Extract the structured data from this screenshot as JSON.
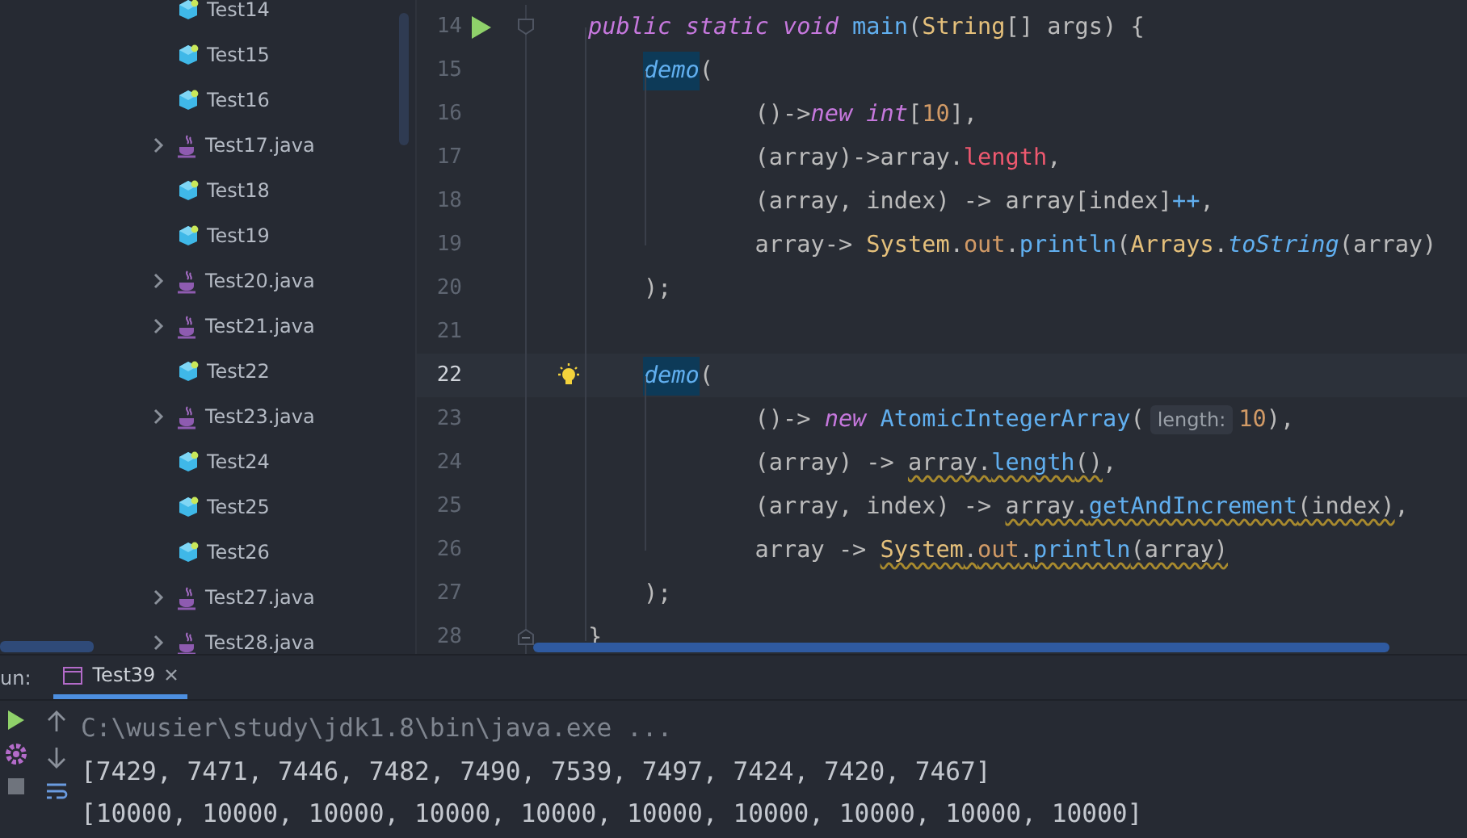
{
  "project_tree": {
    "items": [
      {
        "label": "Test14",
        "kind": "class",
        "expandable": false
      },
      {
        "label": "Test15",
        "kind": "class",
        "expandable": false
      },
      {
        "label": "Test16",
        "kind": "class",
        "expandable": false
      },
      {
        "label": "Test17.java",
        "kind": "file",
        "expandable": true
      },
      {
        "label": "Test18",
        "kind": "class",
        "expandable": false
      },
      {
        "label": "Test19",
        "kind": "class",
        "expandable": false
      },
      {
        "label": "Test20.java",
        "kind": "file",
        "expandable": true
      },
      {
        "label": "Test21.java",
        "kind": "file",
        "expandable": true
      },
      {
        "label": "Test22",
        "kind": "class",
        "expandable": false
      },
      {
        "label": "Test23.java",
        "kind": "file",
        "expandable": true
      },
      {
        "label": "Test24",
        "kind": "class",
        "expandable": false
      },
      {
        "label": "Test25",
        "kind": "class",
        "expandable": false
      },
      {
        "label": "Test26",
        "kind": "class",
        "expandable": false
      },
      {
        "label": "Test27.java",
        "kind": "file",
        "expandable": true
      },
      {
        "label": "Test28.java",
        "kind": "file",
        "expandable": true
      }
    ]
  },
  "editor": {
    "lines": [
      {
        "number": "14",
        "current": false,
        "gutter": {
          "kind": "run"
        },
        "fold": {
          "kind": "start"
        },
        "tokens": [
          {
            "text": "public static void ",
            "kind": "keyword"
          },
          {
            "text": "main",
            "kind": "method"
          },
          {
            "text": "(",
            "kind": "plain"
          },
          {
            "text": "String",
            "kind": "type"
          },
          {
            "text": "[] args) {",
            "kind": "plain"
          }
        ]
      },
      {
        "number": "15",
        "current": false,
        "tokens": [
          {
            "text": "    demo",
            "kind": "call_highlight"
          },
          {
            "text": "(",
            "kind": "plain"
          }
        ]
      },
      {
        "number": "16",
        "current": false,
        "tokens": [
          {
            "text": "            ()->",
            "kind": "plain"
          },
          {
            "text": "new int",
            "kind": "keyword"
          },
          {
            "text": "[",
            "kind": "plain"
          },
          {
            "text": "10",
            "kind": "number"
          },
          {
            "text": "],",
            "kind": "plain"
          }
        ]
      },
      {
        "number": "17",
        "current": false,
        "tokens": [
          {
            "text": "            (array)->array.",
            "kind": "plain"
          },
          {
            "text": "length",
            "kind": "field"
          },
          {
            "text": ",",
            "kind": "plain"
          }
        ]
      },
      {
        "number": "18",
        "current": false,
        "tokens": [
          {
            "text": "            (array, index) -> array[index]",
            "kind": "plain"
          },
          {
            "text": "++",
            "kind": "method"
          },
          {
            "text": ",",
            "kind": "plain"
          }
        ]
      },
      {
        "number": "19",
        "current": false,
        "tokens": [
          {
            "text": "            array-> ",
            "kind": "plain"
          },
          {
            "text": "System",
            "kind": "type"
          },
          {
            "text": ".",
            "kind": "plain"
          },
          {
            "text": "out",
            "kind": "static_field"
          },
          {
            "text": ".",
            "kind": "plain"
          },
          {
            "text": "println",
            "kind": "method"
          },
          {
            "text": "(",
            "kind": "plain"
          },
          {
            "text": "Arrays",
            "kind": "type"
          },
          {
            "text": ".",
            "kind": "plain"
          },
          {
            "text": "toString",
            "kind": "static_method"
          },
          {
            "text": "(array)",
            "kind": "plain"
          }
        ]
      },
      {
        "number": "20",
        "current": false,
        "tokens": [
          {
            "text": "    );",
            "kind": "plain"
          }
        ]
      },
      {
        "number": "21",
        "current": false
      },
      {
        "number": "22",
        "current": true,
        "gutter": {
          "kind": "bulb"
        },
        "tokens": [
          {
            "text": "    demo",
            "kind": "call_highlight"
          },
          {
            "text": "(",
            "kind": "plain"
          }
        ]
      },
      {
        "number": "23",
        "current": false,
        "tokens": [
          {
            "text": "            ()-> ",
            "kind": "plain"
          },
          {
            "text": "new ",
            "kind": "keyword"
          },
          {
            "text": "AtomicIntegerArray",
            "kind": "method"
          },
          {
            "text": "(",
            "kind": "plain"
          },
          {
            "text": "length:",
            "kind": "hint"
          },
          {
            "text": "10",
            "kind": "number"
          },
          {
            "text": "),",
            "kind": "plain"
          }
        ]
      },
      {
        "number": "24",
        "current": false,
        "tokens": [
          {
            "text": "            (array) -> ",
            "kind": "plain",
            "warning": false
          },
          {
            "text": "array.",
            "kind": "plain",
            "warning": true
          },
          {
            "text": "length",
            "kind": "method",
            "warning": true
          },
          {
            "text": "()",
            "kind": "plain",
            "warning": true
          },
          {
            "text": ",",
            "kind": "plain",
            "warning": false
          }
        ]
      },
      {
        "number": "25",
        "current": false,
        "tokens": [
          {
            "text": "            (array, index) -> ",
            "kind": "plain",
            "warning": false
          },
          {
            "text": "array.",
            "kind": "plain",
            "warning": true
          },
          {
            "text": "getAndIncrement",
            "kind": "method",
            "warning": true
          },
          {
            "text": "(index)",
            "kind": "plain",
            "warning": true
          },
          {
            "text": ",",
            "kind": "plain",
            "warning": false
          }
        ]
      },
      {
        "number": "26",
        "current": false,
        "tokens": [
          {
            "text": "            array -> ",
            "kind": "plain",
            "warning": false
          },
          {
            "text": "System",
            "kind": "type",
            "warning": true
          },
          {
            "text": ".",
            "kind": "plain",
            "warning": true
          },
          {
            "text": "out",
            "kind": "static_field",
            "warning": true
          },
          {
            "text": ".",
            "kind": "plain",
            "warning": true
          },
          {
            "text": "println",
            "kind": "method",
            "warning": true
          },
          {
            "text": "(array)",
            "kind": "plain",
            "warning": true
          }
        ]
      },
      {
        "number": "27",
        "current": false,
        "tokens": [
          {
            "text": "    );",
            "kind": "plain"
          }
        ]
      },
      {
        "number": "28",
        "current": false,
        "fold": {
          "kind": "end"
        },
        "tokens": [
          {
            "text": "}",
            "kind": "plain"
          }
        ]
      }
    ]
  },
  "run_panel": {
    "label": "un:",
    "tabs": [
      {
        "label": "Test39",
        "selected": true
      }
    ],
    "output": [
      {
        "text": "C:\\wusier\\study\\jdk1.8\\bin\\java.exe ...",
        "kind": "command"
      },
      {
        "text": "[7429, 7471, 7446, 7482, 7490, 7539, 7497, 7424, 7420, 7467]",
        "kind": "stdout"
      },
      {
        "text": "[10000, 10000, 10000, 10000, 10000, 10000, 10000, 10000, 10000, 10000]",
        "kind": "stdout"
      }
    ]
  }
}
